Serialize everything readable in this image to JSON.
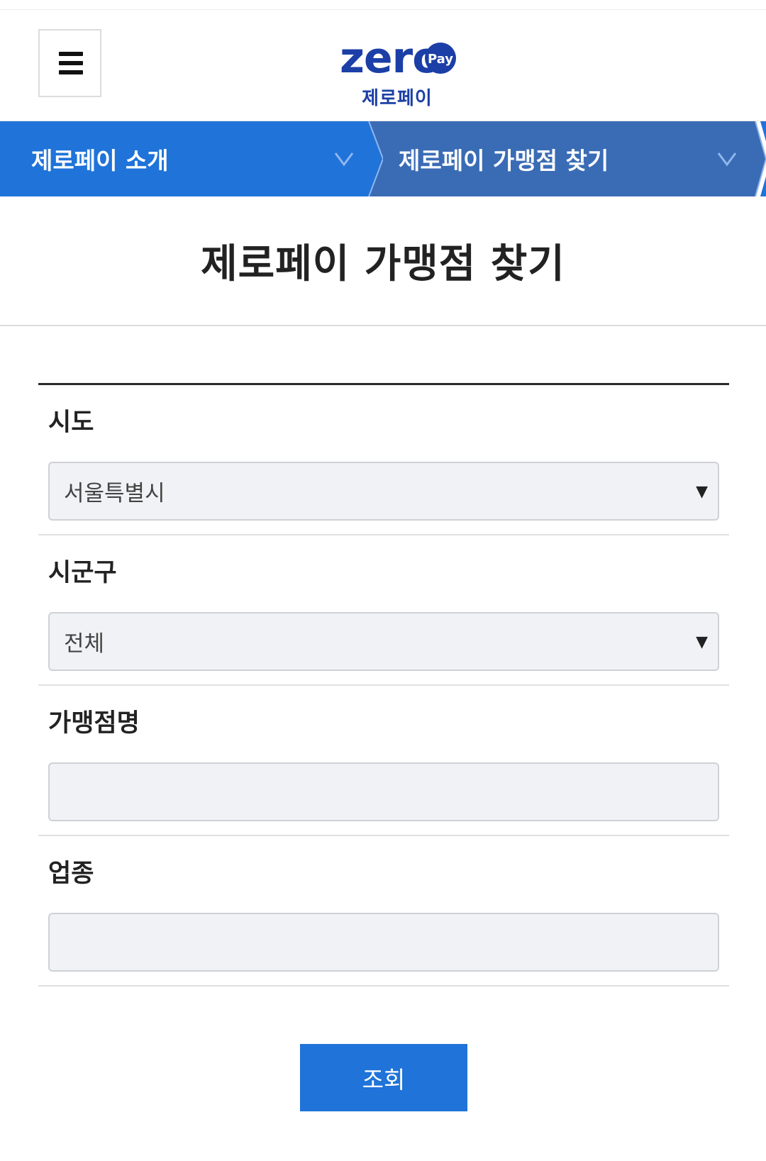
{
  "header": {
    "logo_text": "zero",
    "logo_badge": "Pay",
    "logo_korean": "제로페이"
  },
  "nav": {
    "items": [
      {
        "label": "제로페이 소개"
      },
      {
        "label": "제로페이 가맹점 찾기"
      }
    ]
  },
  "page": {
    "title": "제로페이 가맹점 찾기"
  },
  "form": {
    "fields": [
      {
        "label": "시도",
        "value": "서울특별시",
        "type": "select"
      },
      {
        "label": "시군구",
        "value": "전체",
        "type": "select"
      },
      {
        "label": "가맹점명",
        "value": "",
        "type": "text"
      },
      {
        "label": "업종",
        "value": "",
        "type": "text"
      }
    ],
    "submit_label": "조회"
  },
  "colors": {
    "brand": "#1b3fa6",
    "nav_primary": "#1f73d9",
    "nav_secondary": "#3a6cb5",
    "button": "#1f73d9"
  },
  "icons": {
    "menu": "hamburger-icon",
    "chevron": "chevron-down-icon",
    "dropdown": "dropdown-arrow-icon"
  }
}
